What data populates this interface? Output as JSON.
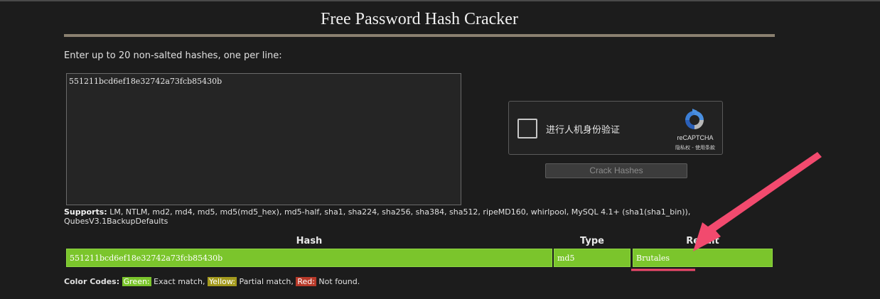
{
  "page": {
    "title": "Free Password Hash Cracker",
    "instructions": "Enter up to 20 non-salted hashes, one per line:"
  },
  "form": {
    "textarea_value": "551211bcd6ef18e32742a73fcb85430b",
    "crack_button_label": "Crack Hashes"
  },
  "recaptcha": {
    "label": "进行人机身份验证",
    "brand": "reCAPTCHA",
    "links": "隐私权 - 使用条款"
  },
  "supports": {
    "label": "Supports:",
    "text": " LM, NTLM, md2, md4, md5, md5(md5_hex), md5-half, sha1, sha224, sha256, sha384, sha512, ripeMD160, whirlpool, MySQL 4.1+ (sha1(sha1_bin)), QubesV3.1BackupDefaults"
  },
  "results": {
    "headers": {
      "hash": "Hash",
      "type": "Type",
      "result": "Result"
    },
    "rows": [
      {
        "hash": "551211bcd6ef18e32742a73fcb85430b",
        "type": "md5",
        "result": "Brutales",
        "status": "green"
      }
    ]
  },
  "color_codes": {
    "label": "Color Codes:",
    "green": {
      "label": "Green:",
      "desc": " Exact match, ",
      "color": "#7bc52c"
    },
    "yellow": {
      "label": "Yellow:",
      "desc": " Partial match, ",
      "color": "#a49a1e"
    },
    "red": {
      "label": "Red:",
      "desc": " Not found.",
      "color": "#b83a2a"
    }
  },
  "annotation": {
    "arrow_color": "#f24a6e",
    "icon": "arrow-annotation"
  }
}
